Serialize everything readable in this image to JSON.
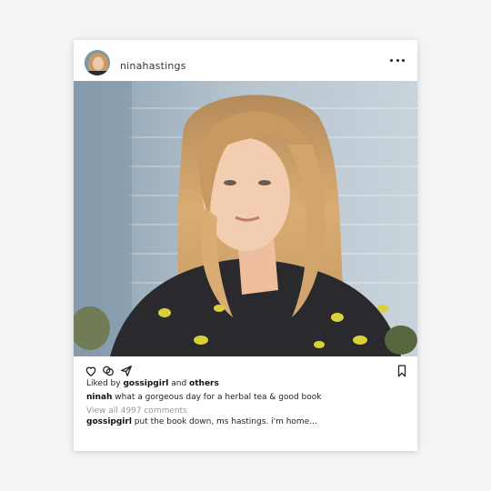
{
  "post": {
    "username": "ninahastings",
    "liked_by_prefix": "Liked by",
    "liked_by_user": "gossipgirl",
    "liked_by_and": "and",
    "liked_by_others": "others",
    "caption_user": "ninah",
    "caption_text": "what a gorgeous day for a herbal tea & good book",
    "view_comments": "View all 4997 comments",
    "comment_user": "gossipgirl",
    "comment_text": "put the book down, ms hastings. i'm home..."
  },
  "icons": {
    "more": "more-options-icon",
    "like": "heart-icon",
    "comment": "comment-bubble-icon",
    "share": "send-icon",
    "save": "bookmark-icon"
  },
  "colors": {
    "background": "#f4f4f4",
    "card": "#ffffff",
    "text": "#222222",
    "muted": "#999999"
  }
}
